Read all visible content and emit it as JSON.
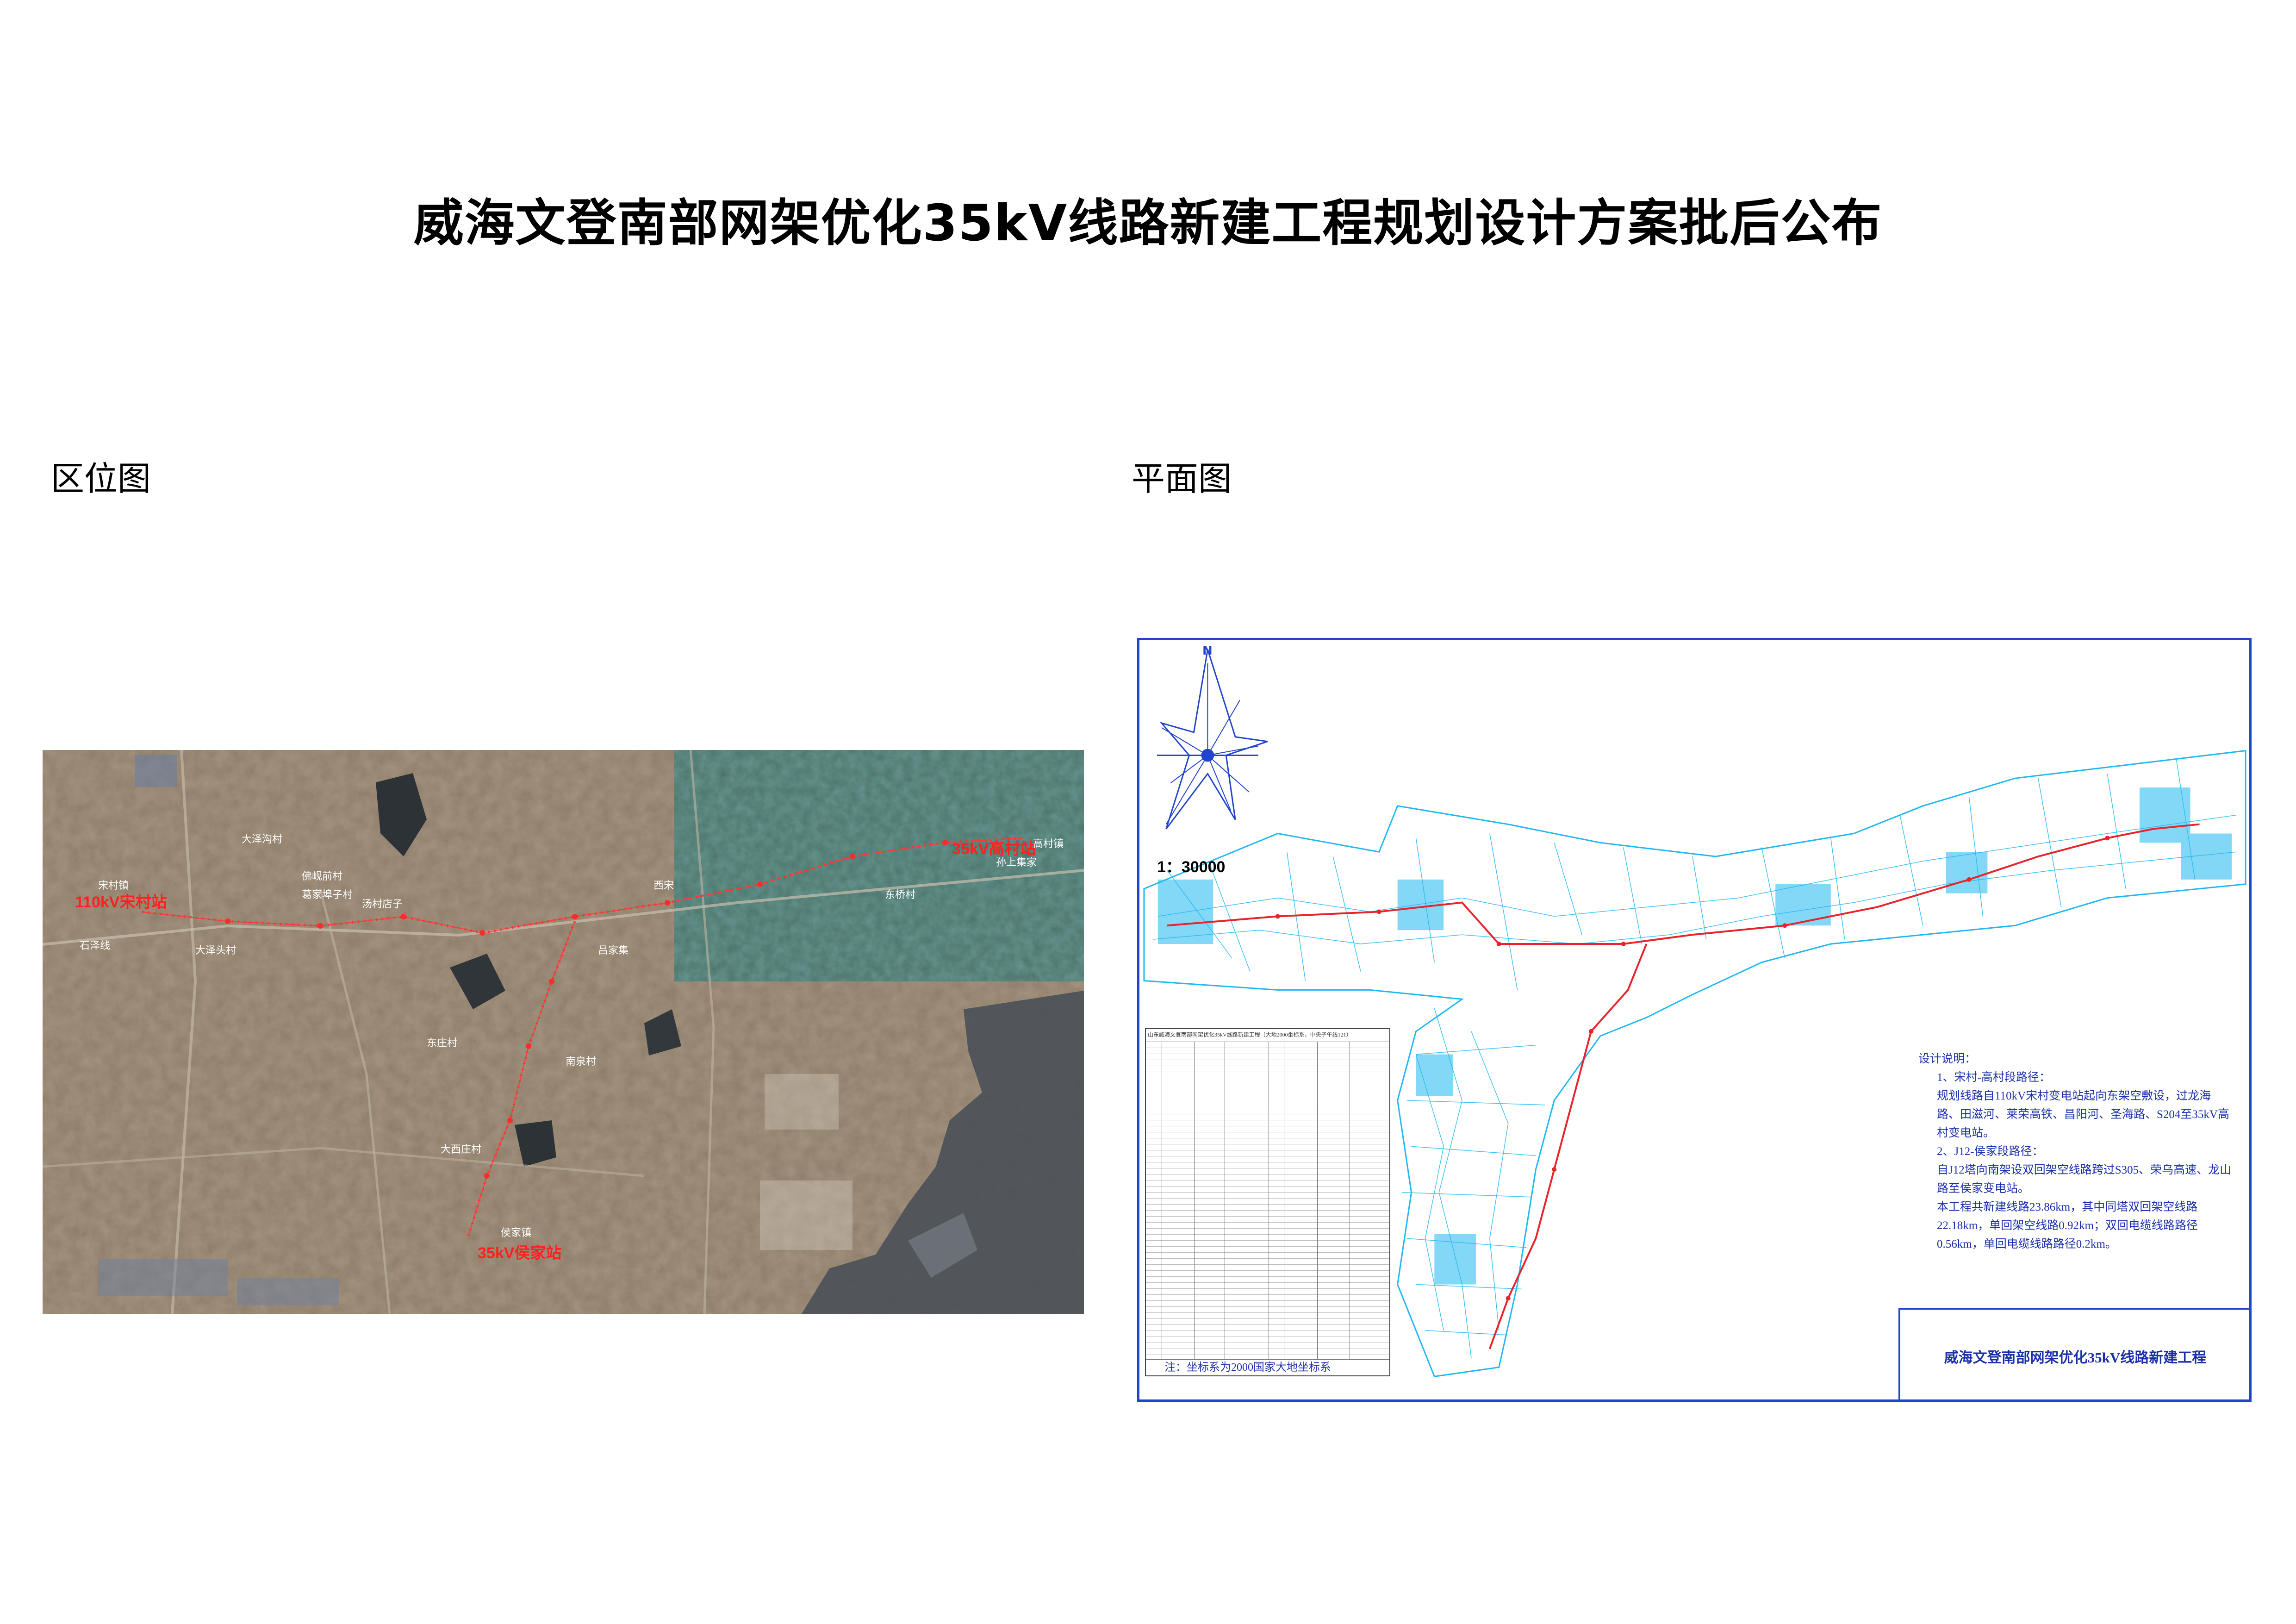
{
  "page": {
    "title": "威海文登南部网架优化35kV线路新建工程规划设计方案批后公布",
    "left_label": "区位图",
    "right_label": "平面图"
  },
  "location_map": {
    "labels": [
      "110kV宋村站",
      "35kV高村站",
      "35kV侯家站",
      "宋村镇",
      "大泽头村",
      "石泽线",
      "大泽沟村",
      "佛岘前村",
      "葛家埠子村",
      "汤村店子",
      "东庄村",
      "南泉村",
      "大西庄村",
      "侯家镇",
      "吕家集",
      "西宋",
      "东桥村",
      "高村镇",
      "孙上集家"
    ],
    "colors": {
      "route": "#ff2b2b",
      "label": "#ff2020",
      "village": "#ffffff"
    }
  },
  "plan_map": {
    "scale": "1：30000",
    "north": "N",
    "table_header": "山东威海文登南部网架优化35kV线路新建工程（大地2000坐标系，中央子午线121）",
    "coord_note": "注：坐标系为2000国家大地坐标系",
    "notes": [
      "设计说明：",
      "1、宋村-高村段路径：",
      "规划线路自110kV宋村变电站起向东架空敷设，过龙海路、田滋河、莱荣高铁、昌阳河、圣海路、S204至35kV高村变电站。",
      "2、J12-侯家段路径：",
      "自J12塔向南架设双回架空线路跨过S305、荣乌高速、龙山路至侯家变电站。",
      "本工程共新建线路23.86km，其中同塔双回架空线路22.18km，单回架空线路0.92km；双回电缆线路路径0.56km，单回电缆线路路径0.2km。"
    ],
    "title_block": "威海文登南部网架优化35kV线路新建工程",
    "colors": {
      "frame": "#2244cc",
      "water": "#1fb8f0",
      "route": "#e8232b",
      "text": "#1a2faa"
    }
  }
}
